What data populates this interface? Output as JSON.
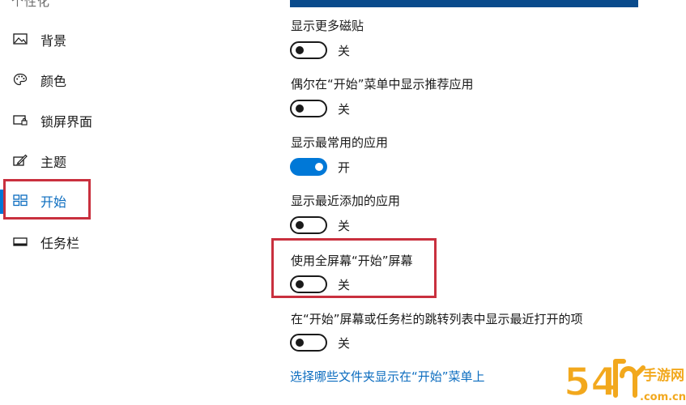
{
  "sidebar": {
    "header": "个性化",
    "items": [
      {
        "label": "背景",
        "icon": "picture-icon"
      },
      {
        "label": "颜色",
        "icon": "palette-icon"
      },
      {
        "label": "锁屏界面",
        "icon": "lock-screen-icon"
      },
      {
        "label": "主题",
        "icon": "theme-brush-icon"
      },
      {
        "label": "开始",
        "icon": "start-tiles-icon",
        "active": true
      },
      {
        "label": "任务栏",
        "icon": "taskbar-icon"
      }
    ]
  },
  "settings": [
    {
      "label": "显示更多磁贴",
      "state": "关",
      "on": false
    },
    {
      "label": "偶尔在“开始”菜单中显示推荐应用",
      "state": "关",
      "on": false
    },
    {
      "label": "显示最常用的应用",
      "state": "开",
      "on": true
    },
    {
      "label": "显示最近添加的应用",
      "state": "关",
      "on": false
    },
    {
      "label": "使用全屏幕“开始”屏幕",
      "state": "关",
      "on": false
    },
    {
      "label": "在“开始”屏幕或任务栏的跳转列表中显示最近打开的项",
      "state": "关",
      "on": false
    }
  ],
  "link": "选择哪些文件夹显示在“开始”菜单上",
  "watermark": {
    "brand": "手游网",
    "digits": "54",
    "domain": ".com.cn"
  },
  "colors": {
    "accent": "#0078d7",
    "highlight": "#c9303e",
    "link": "#0b6cbf",
    "watermark": "#f2a81d"
  }
}
